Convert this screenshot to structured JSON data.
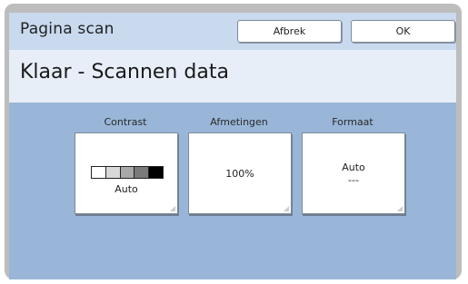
{
  "header": {
    "title": "Pagina scan",
    "cancel_label": "Afbrek",
    "ok_label": "OK"
  },
  "status": {
    "message": "Klaar - Scannen data"
  },
  "settings": [
    {
      "label": "Contrast",
      "value": "Auto"
    },
    {
      "label": "Afmetingen",
      "value": "100%"
    },
    {
      "label": "Formaat",
      "value": "Auto",
      "sub": "---"
    }
  ],
  "colors": {
    "background": "#99b6d8",
    "header": "#c9d9ee",
    "status": "#e7eef8",
    "contrast_levels": [
      "#ffffff",
      "#d9d9d9",
      "#a8a8a8",
      "#7a7a7a",
      "#000000"
    ]
  },
  "icons": {
    "contrast": "contrast-scale-icon"
  }
}
